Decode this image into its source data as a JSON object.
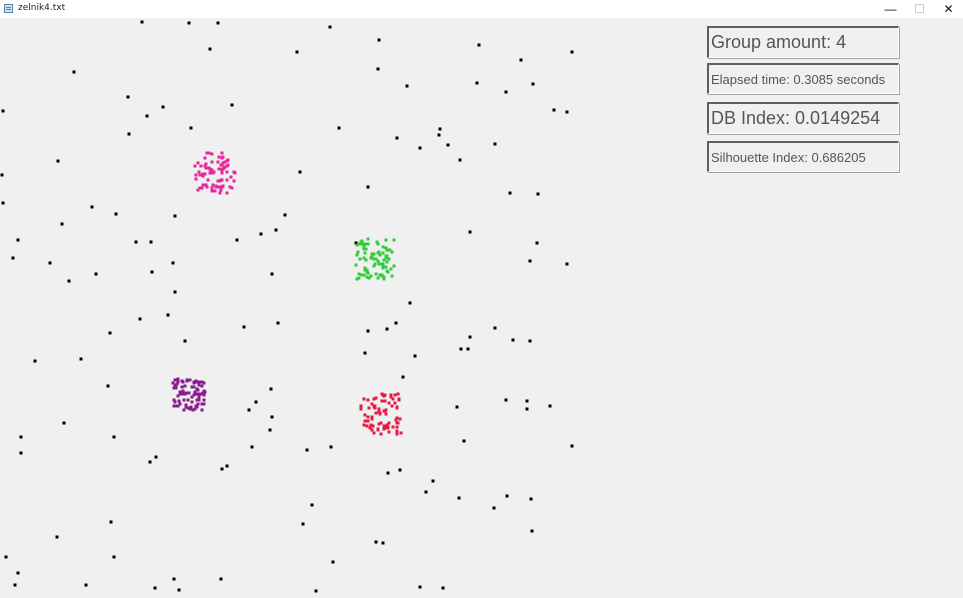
{
  "window": {
    "title": "zelnik4.txt",
    "minimize_glyph": "—",
    "maximize_glyph": "☐",
    "close_glyph": "✕"
  },
  "stats": {
    "group_amount": "Group amount: 4",
    "elapsed_time": "Elapsed time: 0.3085 seconds",
    "db_index": "DB Index: 0.0149254",
    "silhouette_index": "Silhouette Index: 0.686205"
  },
  "colors": {
    "noise": "#000000",
    "cluster_magenta": "#e8259b",
    "cluster_green": "#2fcb38",
    "cluster_purple": "#8a1a8c",
    "cluster_red": "#e21a45"
  },
  "scatter": {
    "noise_points": [
      [
        142,
        22
      ],
      [
        189,
        23
      ],
      [
        218,
        23
      ],
      [
        330,
        27
      ],
      [
        379,
        40
      ],
      [
        479,
        45
      ],
      [
        210,
        49
      ],
      [
        297,
        52
      ],
      [
        572,
        52
      ],
      [
        521,
        60
      ],
      [
        74,
        72
      ],
      [
        378,
        69
      ],
      [
        477,
        83
      ],
      [
        533,
        84
      ],
      [
        407,
        86
      ],
      [
        506,
        92
      ],
      [
        128,
        97
      ],
      [
        232,
        105
      ],
      [
        163,
        107
      ],
      [
        3,
        111
      ],
      [
        554,
        110
      ],
      [
        567,
        112
      ],
      [
        147,
        116
      ],
      [
        191,
        128
      ],
      [
        339,
        128
      ],
      [
        440,
        129
      ],
      [
        129,
        134
      ],
      [
        439,
        135
      ],
      [
        397,
        138
      ],
      [
        448,
        145
      ],
      [
        420,
        148
      ],
      [
        495,
        144
      ],
      [
        460,
        160
      ],
      [
        58,
        161
      ],
      [
        300,
        172
      ],
      [
        2,
        175
      ],
      [
        368,
        187
      ],
      [
        510,
        193
      ],
      [
        538,
        194
      ],
      [
        3,
        203
      ],
      [
        92,
        207
      ],
      [
        116,
        214
      ],
      [
        175,
        216
      ],
      [
        285,
        215
      ],
      [
        62,
        224
      ],
      [
        276,
        230
      ],
      [
        470,
        232
      ],
      [
        261,
        234
      ],
      [
        18,
        240
      ],
      [
        136,
        242
      ],
      [
        151,
        242
      ],
      [
        237,
        240
      ],
      [
        356,
        243
      ],
      [
        537,
        243
      ],
      [
        13,
        258
      ],
      [
        50,
        263
      ],
      [
        173,
        263
      ],
      [
        530,
        261
      ],
      [
        567,
        264
      ],
      [
        152,
        272
      ],
      [
        272,
        274
      ],
      [
        96,
        274
      ],
      [
        69,
        281
      ],
      [
        175,
        292
      ],
      [
        410,
        303
      ],
      [
        168,
        315
      ],
      [
        140,
        319
      ],
      [
        278,
        323
      ],
      [
        396,
        323
      ],
      [
        244,
        327
      ],
      [
        387,
        329
      ],
      [
        495,
        328
      ],
      [
        110,
        333
      ],
      [
        368,
        331
      ],
      [
        470,
        337
      ],
      [
        513,
        340
      ],
      [
        530,
        341
      ],
      [
        185,
        341
      ],
      [
        468,
        349
      ],
      [
        461,
        349
      ],
      [
        365,
        353
      ],
      [
        415,
        356
      ],
      [
        81,
        359
      ],
      [
        35,
        361
      ],
      [
        403,
        377
      ],
      [
        271,
        389
      ],
      [
        108,
        386
      ],
      [
        506,
        400
      ],
      [
        527,
        401
      ],
      [
        527,
        409
      ],
      [
        550,
        406
      ],
      [
        256,
        402
      ],
      [
        457,
        407
      ],
      [
        249,
        410
      ],
      [
        272,
        417
      ],
      [
        270,
        430
      ],
      [
        64,
        423
      ],
      [
        21,
        437
      ],
      [
        114,
        437
      ],
      [
        464,
        441
      ],
      [
        572,
        446
      ],
      [
        21,
        453
      ],
      [
        252,
        447
      ],
      [
        307,
        450
      ],
      [
        331,
        447
      ],
      [
        156,
        457
      ],
      [
        150,
        462
      ],
      [
        227,
        466
      ],
      [
        222,
        469
      ],
      [
        388,
        473
      ],
      [
        400,
        470
      ],
      [
        433,
        481
      ],
      [
        426,
        492
      ],
      [
        459,
        498
      ],
      [
        507,
        496
      ],
      [
        531,
        499
      ],
      [
        494,
        508
      ],
      [
        312,
        505
      ],
      [
        111,
        522
      ],
      [
        303,
        524
      ],
      [
        532,
        531
      ],
      [
        57,
        537
      ],
      [
        376,
        542
      ],
      [
        383,
        543
      ],
      [
        6,
        557
      ],
      [
        114,
        557
      ],
      [
        333,
        562
      ],
      [
        18,
        573
      ],
      [
        174,
        579
      ],
      [
        221,
        579
      ],
      [
        15,
        585
      ],
      [
        86,
        585
      ],
      [
        155,
        588
      ],
      [
        179,
        590
      ],
      [
        316,
        591
      ],
      [
        420,
        587
      ],
      [
        443,
        588
      ]
    ],
    "clusters": [
      {
        "color_key": "cluster_magenta",
        "center": [
          215,
          173
        ],
        "half_size": [
          20,
          20
        ]
      },
      {
        "color_key": "cluster_green",
        "center": [
          375,
          259
        ],
        "half_size": [
          20,
          20
        ]
      },
      {
        "color_key": "cluster_purple",
        "center": [
          189,
          395
        ],
        "half_size": [
          16,
          16
        ]
      },
      {
        "color_key": "cluster_red",
        "center": [
          381,
          414
        ],
        "half_size": [
          20,
          20
        ]
      }
    ]
  }
}
